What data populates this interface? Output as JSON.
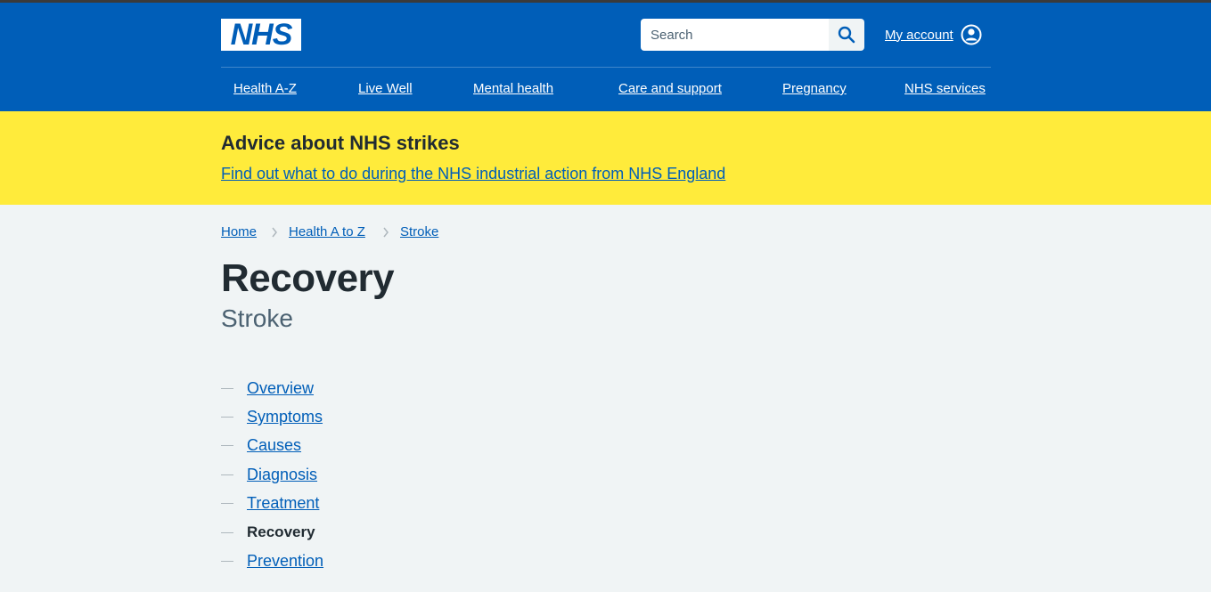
{
  "header": {
    "logo_text": "NHS",
    "search": {
      "placeholder": "Search",
      "value": ""
    },
    "account_label": "My account",
    "brand_color": "#005eb8",
    "nav": [
      "Health A-Z",
      "Live Well",
      "Mental health",
      "Care and support",
      "Pregnancy",
      "NHS services"
    ]
  },
  "banner": {
    "title": "Advice about NHS strikes",
    "link": "Find out what to do during the NHS industrial action from NHS England",
    "color": "#ffeb3b"
  },
  "breadcrumb": [
    "Home",
    "Health A to Z",
    "Stroke"
  ],
  "page": {
    "title": "Recovery",
    "caption": "Stroke"
  },
  "contents": {
    "items": [
      "Overview",
      "Symptoms",
      "Causes",
      "Diagnosis",
      "Treatment",
      "Recovery",
      "Prevention"
    ],
    "current": "Recovery"
  },
  "icons": [
    "search-icon",
    "user-account-icon",
    "chevron-right-icon"
  ]
}
